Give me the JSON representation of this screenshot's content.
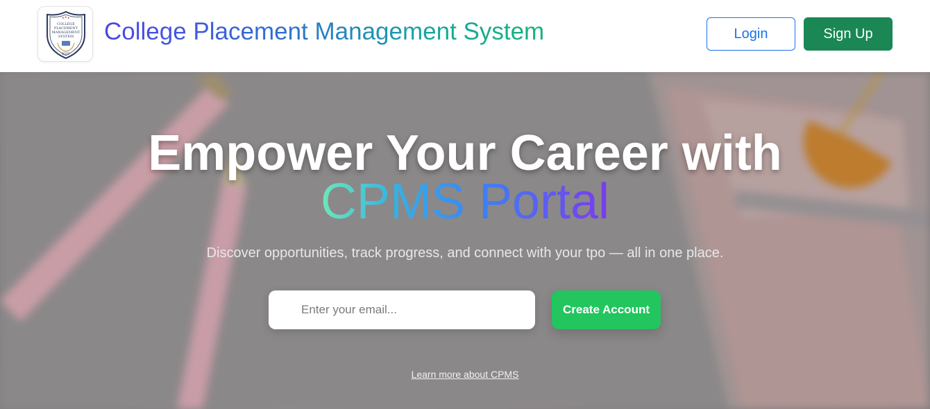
{
  "header": {
    "logo": {
      "icon": "shield-emblem-icon",
      "lines": [
        "COLLEGE",
        "PLACEMENT",
        "MANAGEMENT",
        "SYSTEM"
      ],
      "footer": "EST."
    },
    "brand_title": "College Placement Management System",
    "login_label": "Login",
    "signup_label": "Sign Up"
  },
  "hero": {
    "title_line1": "Empower Your Career with",
    "title_line2": "CPMS Portal",
    "subtitle": "Discover opportunities, track progress, and connect with your tpo — all in one place.",
    "email_placeholder": "Enter your email...",
    "email_value": "",
    "cta_label": "Create Account",
    "learn_more_label": "Learn more about CPMS"
  },
  "colors": {
    "login_border": "#1a73e8",
    "signup_bg": "#1a8754",
    "cta_bg": "#22c55e",
    "brand_gradient": [
      "#4f46e5",
      "#16a6a0",
      "#19b37a"
    ],
    "accent_gradient": [
      "#6ee7b7",
      "#3b82f6",
      "#7c3aed"
    ]
  }
}
